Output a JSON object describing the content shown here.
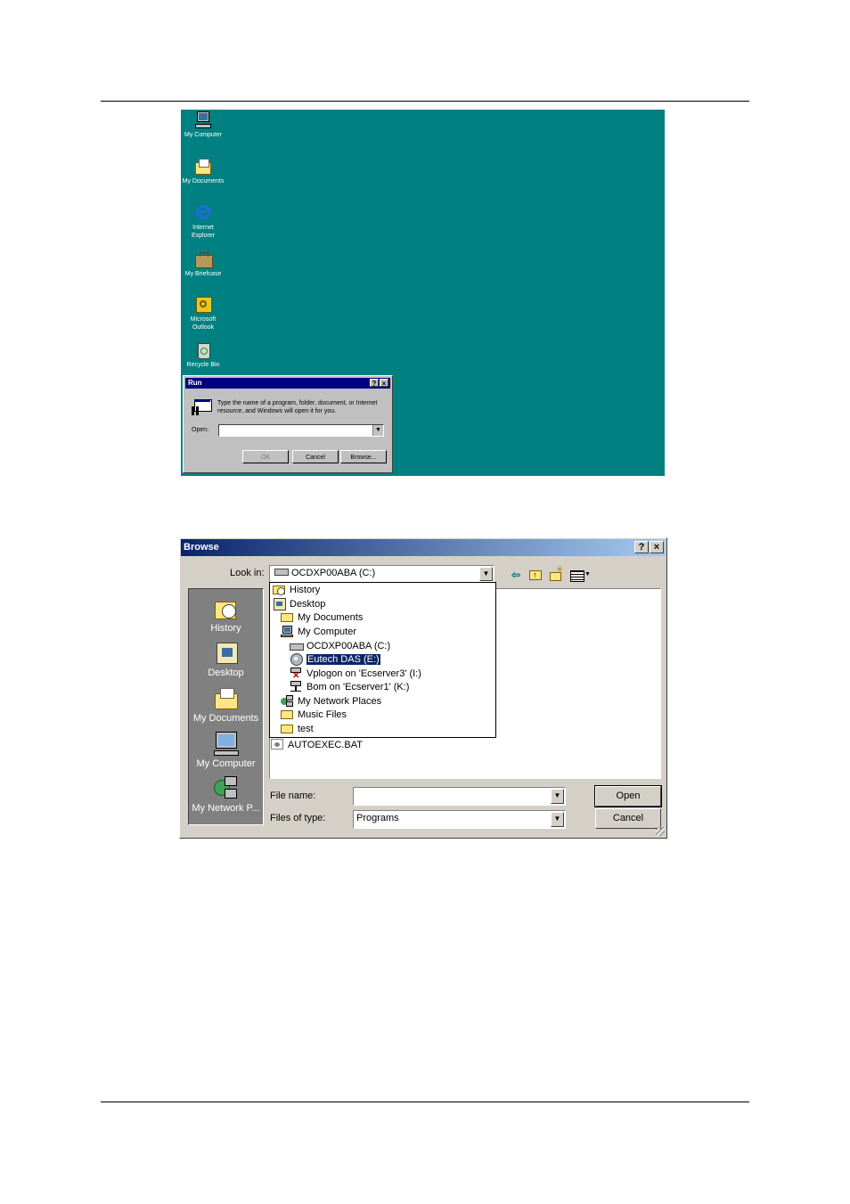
{
  "desktop": {
    "icons": [
      {
        "label": "My Computer",
        "icon": "computer-icon"
      },
      {
        "label": "My Documents",
        "icon": "folder-icon"
      },
      {
        "label": "Internet\nExplorer",
        "icon": "internet-explorer-icon"
      },
      {
        "label": "My Briefcase",
        "icon": "briefcase-icon"
      },
      {
        "label": "Microsoft\nOutlook",
        "icon": "outlook-icon"
      },
      {
        "label": "Recycle Bin",
        "icon": "recycle-bin-icon"
      }
    ],
    "background_color": "#008080"
  },
  "run_dialog": {
    "title": "Run",
    "help_btn": "?",
    "close_btn": "×",
    "description": "Type the name of a program, folder, document, or Internet resource, and Windows will open it for you.",
    "open_label": "Open:",
    "open_value": "",
    "ok_label": "OK",
    "cancel_label": "Cancel",
    "browse_label": "Browse..."
  },
  "browse_dialog": {
    "title": "Browse",
    "help_btn": "?",
    "close_btn": "×",
    "look_in_label": "Look in:",
    "look_in_value": "OCDXP00ABA (C:)",
    "places": [
      {
        "label": "History",
        "icon": "history-icon"
      },
      {
        "label": "Desktop",
        "icon": "desktop-icon"
      },
      {
        "label": "My Documents",
        "icon": "my-documents-icon"
      },
      {
        "label": "My Computer",
        "icon": "my-computer-icon"
      },
      {
        "label": "My Network P...",
        "icon": "network-places-icon"
      }
    ],
    "dropdown_items": [
      {
        "label": "History",
        "icon": "history-icon"
      },
      {
        "label": "Desktop",
        "icon": "desktop-icon"
      },
      {
        "label": "My Documents",
        "icon": "folder-icon"
      },
      {
        "label": "My Computer",
        "icon": "computer-icon"
      },
      {
        "label": "OCDXP00ABA (C:)",
        "icon": "hard-drive-icon"
      },
      {
        "label": "Eutech DAS (E:)",
        "icon": "cd-drive-icon",
        "selected": true
      },
      {
        "label": "Vplogon on 'Ecserver3' (I:)",
        "icon": "disconnected-drive-icon"
      },
      {
        "label": "Bom on 'Ecserver1' (K:)",
        "icon": "network-drive-icon"
      },
      {
        "label": "My Network Places",
        "icon": "network-places-icon"
      },
      {
        "label": "Music Files",
        "icon": "folder-icon"
      },
      {
        "label": "test",
        "icon": "folder-icon"
      }
    ],
    "file_list": [
      {
        "label": "AUTOEXEC.BAT",
        "icon": "batch-file-icon"
      }
    ],
    "file_name_label": "File name:",
    "file_name_value": "",
    "files_of_type_label": "Files of type:",
    "files_of_type_value": "Programs",
    "open_label": "Open",
    "cancel_label": "Cancel"
  }
}
